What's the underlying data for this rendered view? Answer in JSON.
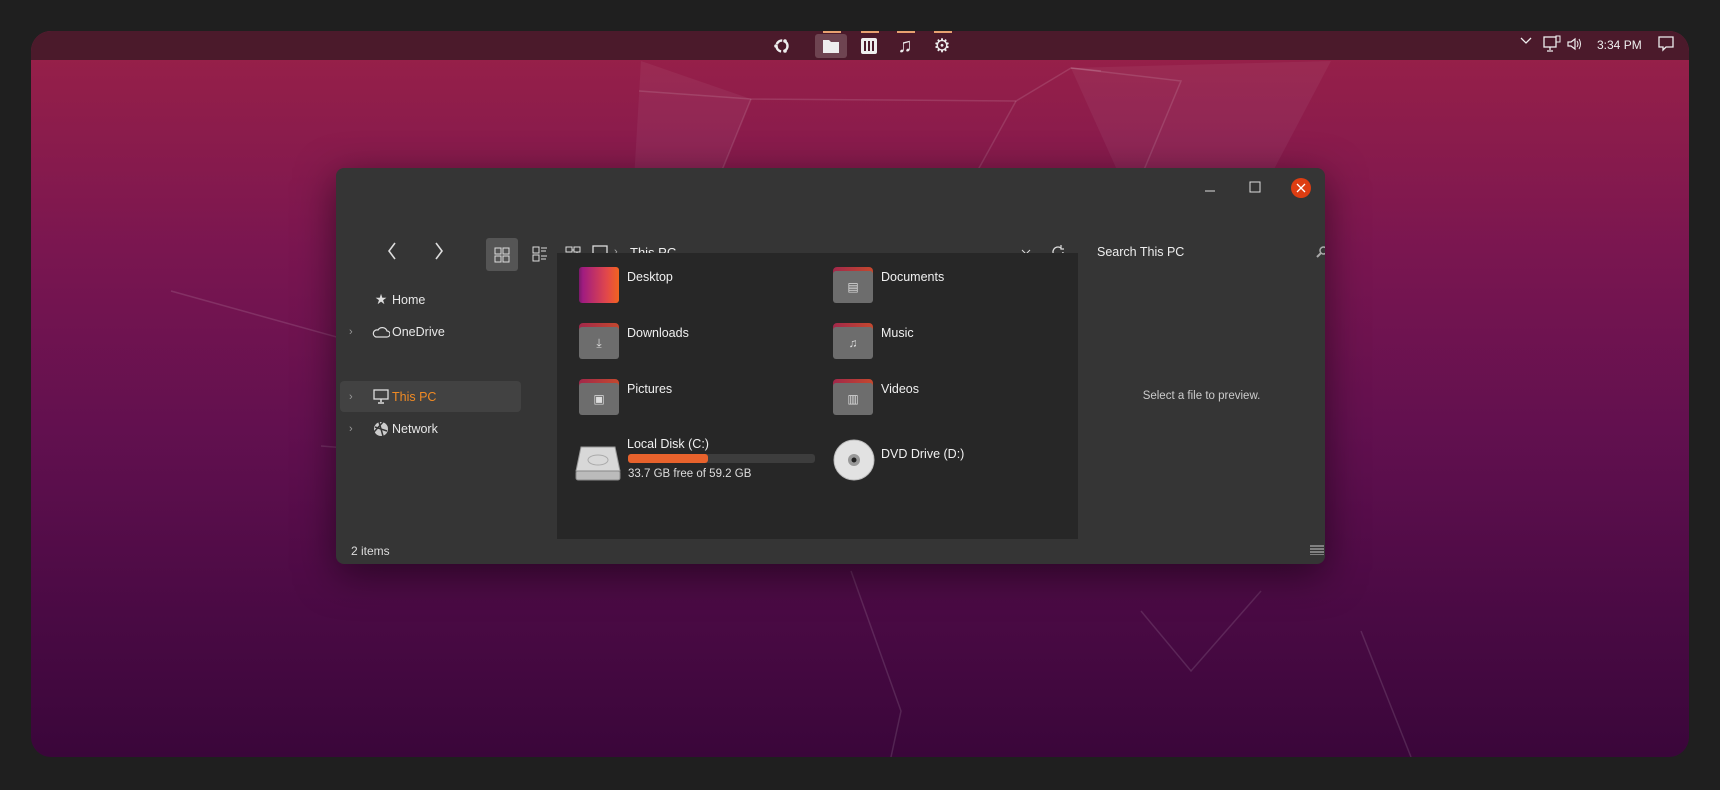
{
  "taskbar": {
    "apps": [
      {
        "name": "ubuntu-logo",
        "active": false
      },
      {
        "name": "files",
        "active": true
      },
      {
        "name": "mixer",
        "active": false
      },
      {
        "name": "music",
        "active": false
      },
      {
        "name": "settings",
        "active": false
      }
    ],
    "tray": {
      "time": "3:34 PM"
    }
  },
  "window": {
    "breadcrumb": {
      "location": "This PC"
    },
    "search": {
      "placeholder": "Search This PC"
    },
    "sidebar": [
      {
        "label": "Home",
        "icon": "star-icon",
        "expandable": false,
        "selected": false
      },
      {
        "label": "OneDrive",
        "icon": "cloud-icon",
        "expandable": true,
        "selected": false
      },
      {
        "label": "This PC",
        "icon": "monitor-icon",
        "expandable": true,
        "selected": true
      },
      {
        "label": "Network",
        "icon": "network-icon",
        "expandable": true,
        "selected": false
      }
    ],
    "items": [
      {
        "label": "Desktop",
        "type": "desktop"
      },
      {
        "label": "Documents",
        "type": "documents"
      },
      {
        "label": "Downloads",
        "type": "downloads"
      },
      {
        "label": "Music",
        "type": "music"
      },
      {
        "label": "Pictures",
        "type": "pictures"
      },
      {
        "label": "Videos",
        "type": "videos"
      }
    ],
    "drives": [
      {
        "label": "Local Disk (C:)",
        "free_text": "33.7 GB free of 59.2 GB",
        "used_fraction": 0.43
      },
      {
        "label": "DVD Drive (D:)"
      }
    ],
    "preview_text": "Select a file to preview.",
    "status": "2 items",
    "colors": {
      "accent": "#f08a24",
      "close": "#dd3d12",
      "bar": "#e8622c"
    }
  }
}
